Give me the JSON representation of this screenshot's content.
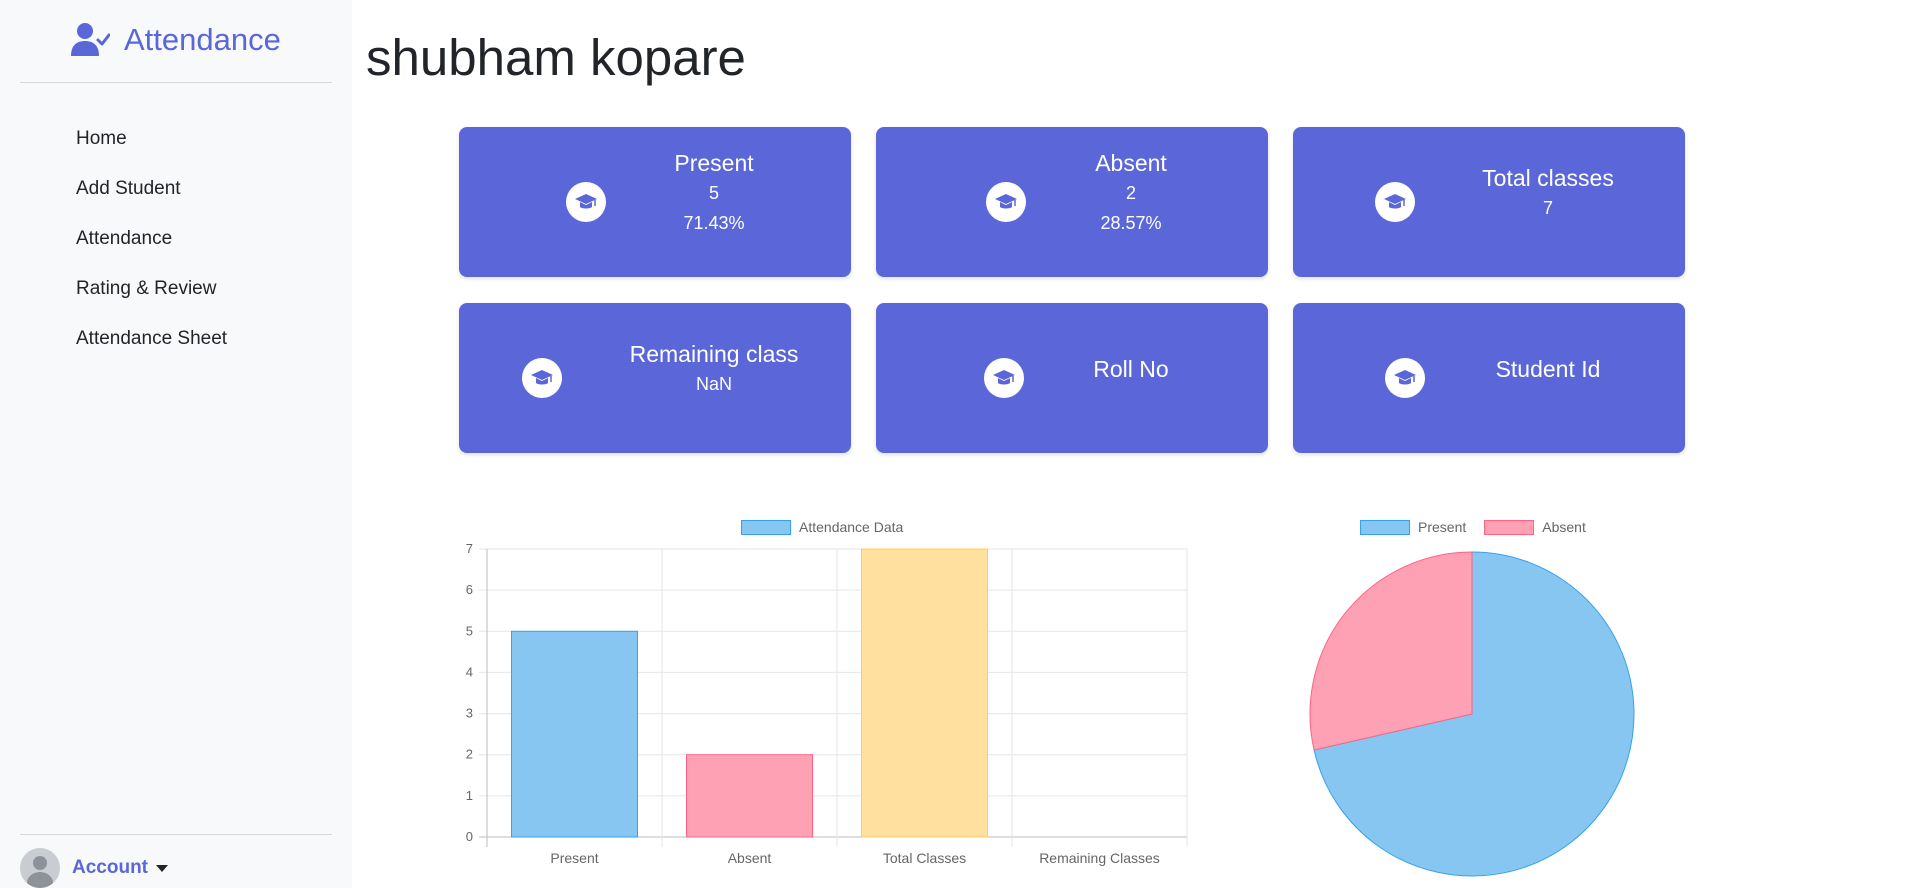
{
  "sidebar": {
    "brand": "Attendance",
    "brand_icon": "user-check-icon",
    "nav": [
      {
        "label": "Home"
      },
      {
        "label": "Add Student"
      },
      {
        "label": "Attendance"
      },
      {
        "label": "Rating & Review"
      },
      {
        "label": "Attendance Sheet"
      }
    ],
    "account_label": "Account"
  },
  "main": {
    "student_name": "shubham kopare",
    "cards": [
      {
        "title": "Present",
        "lines": [
          "5",
          "71.43%"
        ],
        "icon": "graduation-cap-icon"
      },
      {
        "title": "Absent",
        "lines": [
          "2",
          "28.57%"
        ],
        "icon": "graduation-cap-icon"
      },
      {
        "title": "Total classes",
        "lines": [
          "7"
        ],
        "icon": "graduation-cap-icon"
      },
      {
        "title": "Remaining class",
        "lines": [
          "NaN"
        ],
        "icon": "graduation-cap-icon"
      },
      {
        "title": "Roll No",
        "lines": [],
        "icon": "graduation-cap-icon"
      },
      {
        "title": "Student Id",
        "lines": [],
        "icon": "graduation-cap-icon"
      }
    ]
  },
  "colors": {
    "accent": "#5a67d8",
    "card_bg": "#5b67d8",
    "blue": "#87c6f1",
    "blue_border": "#36a2eb",
    "pink": "#ffa1b5",
    "pink_border": "#ff6384",
    "yellow": "#ffe09f",
    "yellow_border": "#ffce56"
  },
  "chart_data": [
    {
      "type": "bar",
      "title": "",
      "xlabel": "",
      "ylabel": "",
      "categories": [
        "Present",
        "Absent",
        "Total Classes",
        "Remaining Classes"
      ],
      "series": [
        {
          "name": "Attendance Data",
          "values": [
            5,
            2,
            7,
            null
          ]
        }
      ],
      "ylim": [
        0,
        7
      ],
      "yticks": [
        0,
        1,
        2,
        3,
        4,
        5,
        6,
        7
      ],
      "grid": true,
      "legend": "top"
    },
    {
      "type": "pie",
      "title": "",
      "labels": [
        "Present",
        "Absent"
      ],
      "values": [
        5,
        2
      ],
      "legend": "top"
    }
  ]
}
